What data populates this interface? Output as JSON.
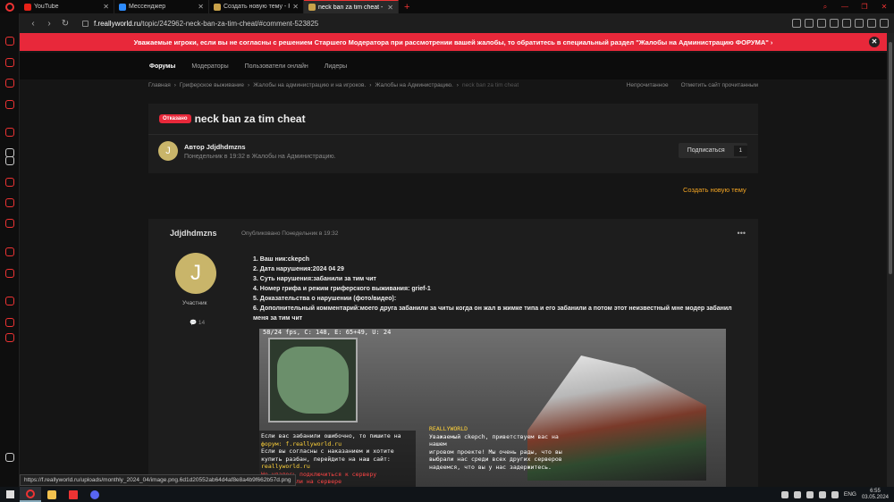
{
  "tabs": [
    {
      "label": "YouTube",
      "color": "#e62117"
    },
    {
      "label": "Мессенджер",
      "color": "#2d8cff"
    },
    {
      "label": "Создать новую тему - Rea",
      "color": "#c9a24a"
    },
    {
      "label": "neck ban za tim cheat - Ж",
      "color": "#c9a24a",
      "active": true
    }
  ],
  "address": {
    "host": "f.reallyworld.ru",
    "path": "/topic/242962-neck-ban-za-tim-cheat/#comment-523825"
  },
  "notice": {
    "text": "Уважаемые игроки, если вы не согласны с решением Старшего Модератора при рассмотрении вашей жалобы, то обратитесь в специальный раздел \"Жалобы на Администрацию ФОРУМА\" ›",
    "close": "✕"
  },
  "nav": {
    "forums": "Форумы",
    "moderators": "Модераторы",
    "online": "Пользователи онлайн",
    "leaders": "Лидеры"
  },
  "breadcrumbs": [
    "Главная",
    "›",
    "Гриферское выживание",
    "›",
    "Жалобы на администрацию и на игроков.",
    "›",
    "Жалобы на Администрацию.",
    "›",
    "neck ban za tim cheat"
  ],
  "crumb_actions": {
    "unread": "Непрочитанное",
    "mark_read": "Отметить сайт прочитанным"
  },
  "topic": {
    "badge": "Отказано",
    "title": "neck ban za tim cheat",
    "author_line": "Автор Jdjdhdmzns",
    "meta": "Понедельник в 19:32 в Жалобы на Администрацию.",
    "avatar_letter": "J",
    "subscribe": "Подписаться",
    "subscribe_count": "1"
  },
  "create_topic": "Создать новую тему",
  "post": {
    "username": "Jdjdhdmzns",
    "avatar_letter": "J",
    "role": "Участник",
    "post_count": "💬 14",
    "date": "Опубликовано Понедельник в 19:32",
    "more": "•••",
    "lines": [
      "1. Ваш ник:ckepch",
      "2. Дата нарушения:2024 04 29",
      "3. Суть нарушения:забанили за тим чит",
      "4. Номер грифа и режим гриферского выживания: grief-1",
      "5. Доказательства о нарушении (фото/видео):",
      "6. Дополнительный комментарий:моего друга забанили за читы когда он жал в жимке типа и его забанили а потом  этот неизвестный мне модер забанил",
      "меня за тим чит"
    ]
  },
  "screenshot": {
    "hud": "58/24 fps, C: 148, E: 65+49, U: 24",
    "chat_lines": [
      {
        "text": "Если вас забанили ошибочно, то пишите на",
        "color": "white"
      },
      {
        "text": "форум: f.reallyworld.ru",
        "color": "yellow"
      },
      {
        "text": "Если вы согласны с наказанием и хотите",
        "color": "white"
      },
      {
        "text": "купить разбан, перейдите на наш сайт:",
        "color": "white"
      },
      {
        "text": "reallyworld.ru",
        "color": "yellow"
      },
      {
        "text": "Не удалось подключиться к серверу",
        "color": "red"
      },
      {
        "text": "Вас забанили на сервере",
        "color": "red"
      }
    ],
    "chat2_lines": [
      "REALLYWORLD",
      "Уважаемый ckepch, приветствуем вас на нашем",
      "игровом проекте! Мы очень рады, что вы",
      "выбрали нас среди всех других серверов",
      "надеемся, что вы у нас задержитесь."
    ]
  },
  "status_url": "https://f.reallyworld.ru/uploads/monthly_2024_04/image.png.6d1d20552ab64d4af8e8a4b9f662b57d.png",
  "taskbar": {
    "lang": "ENG",
    "time": "6:55",
    "date": "03.05.2024"
  }
}
